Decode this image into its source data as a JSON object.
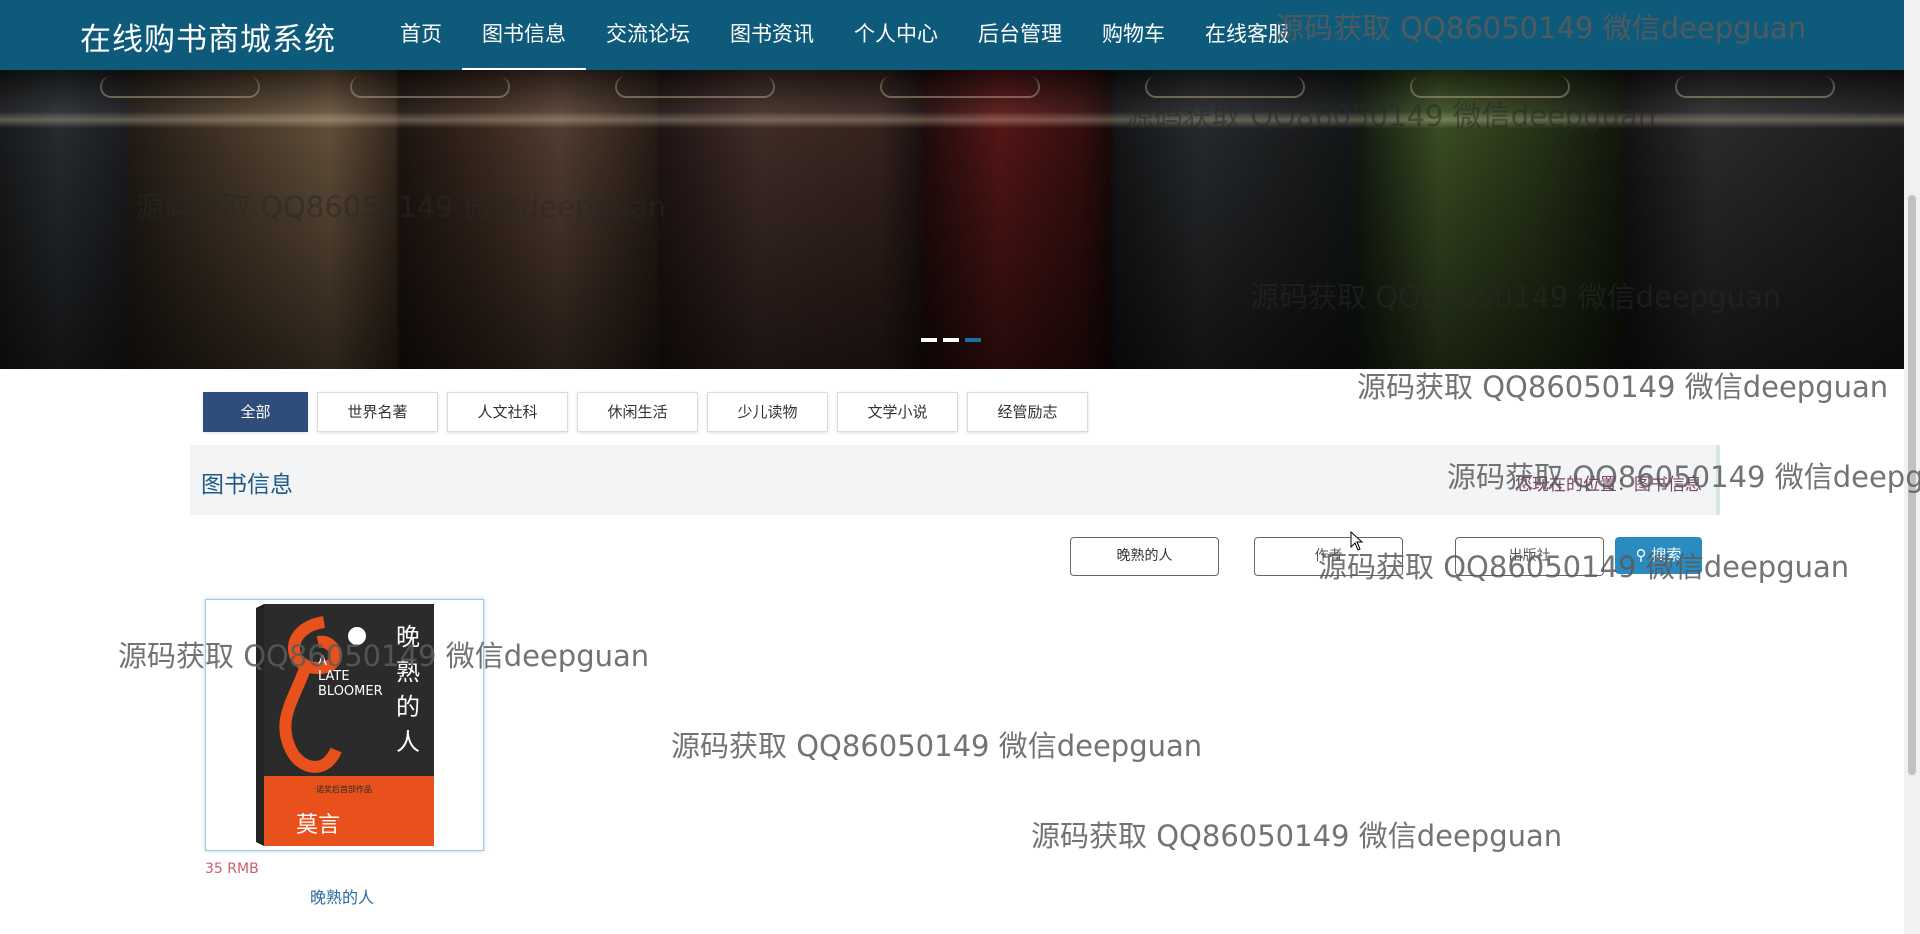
{
  "brand": {
    "title": "在线购书商城系统"
  },
  "nav": {
    "items": [
      {
        "label": "首页"
      },
      {
        "label": "图书信息"
      },
      {
        "label": "交流论坛"
      },
      {
        "label": "图书资讯"
      },
      {
        "label": "个人中心"
      },
      {
        "label": "后台管理"
      },
      {
        "label": "购物车"
      },
      {
        "label": "在线客服"
      }
    ],
    "active_index": 1
  },
  "banner": {
    "slides": 3,
    "active_slide": 3
  },
  "categories": [
    {
      "label": "全部"
    },
    {
      "label": "世界名著"
    },
    {
      "label": "人文社科"
    },
    {
      "label": "休闲生活"
    },
    {
      "label": "少儿读物"
    },
    {
      "label": "文学小说"
    },
    {
      "label": "经管励志"
    }
  ],
  "section": {
    "title": "图书信息",
    "breadcrumb": "您现在的位置：图书信息"
  },
  "search": {
    "name_value": "晚熟的人",
    "author_value": "作者",
    "publisher_value": "出版社",
    "button_label": "搜索",
    "search_icon": "search-icon"
  },
  "products": [
    {
      "name": "晚熟的人",
      "price": "35 RMB",
      "cover": {
        "title_cn": "晚熟的人",
        "title_en": "A LATE BLOOMER",
        "author": "莫言",
        "tagline": "诺奖后首部作品",
        "colors": {
          "bg": "#2b2b2b",
          "accent": "#e8501c",
          "text": "#ffffff"
        }
      }
    }
  ],
  "watermark": {
    "text": "源码获取 QQ86050149 微信deepguan"
  },
  "colors": {
    "navbar": "#0e5a7a",
    "active_category": "#2f4d7a",
    "search_button": "#2a8bc0",
    "price": "#d05a6e",
    "link": "#2a6aa0"
  }
}
